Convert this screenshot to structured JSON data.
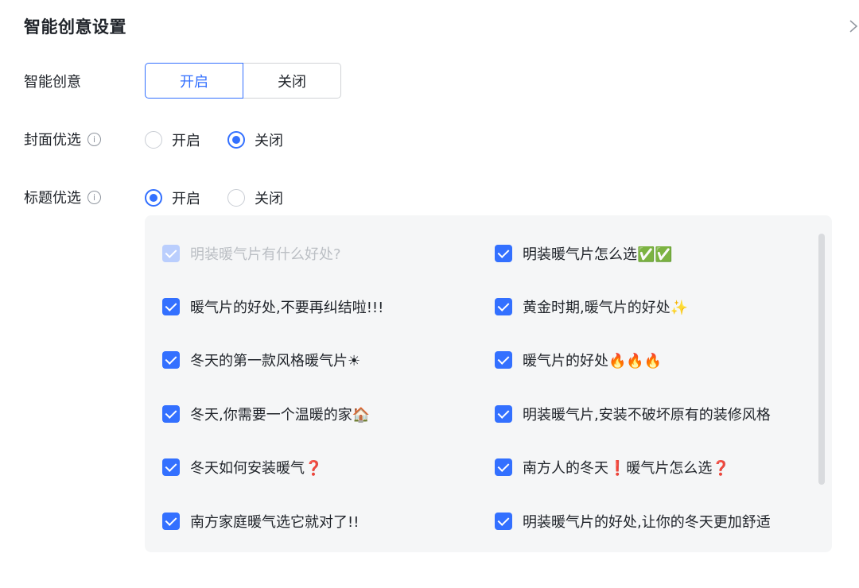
{
  "section": {
    "title": "智能创意设置"
  },
  "smart_creative": {
    "label": "智能创意",
    "options": [
      "开启",
      "关闭"
    ],
    "selected": "开启"
  },
  "cover_optimize": {
    "label": "封面优选",
    "info_icon": "info-icon",
    "options": [
      "开启",
      "关闭"
    ],
    "selected": "关闭"
  },
  "title_optimize": {
    "label": "标题优选",
    "info_icon": "info-icon",
    "options": [
      "开启",
      "关闭"
    ],
    "selected": "开启"
  },
  "titles": [
    {
      "text": "明装暖气片有什么好处?",
      "checked": true,
      "disabled": true
    },
    {
      "text": "明装暖气片怎么选✅✅",
      "checked": true,
      "disabled": false
    },
    {
      "text": "暖气片的好处,不要再纠结啦!!!",
      "checked": true,
      "disabled": false
    },
    {
      "text": "黄金时期,暖气片的好处✨",
      "checked": true,
      "disabled": false
    },
    {
      "text": "冬天的第一款风格暖气片☀",
      "checked": true,
      "disabled": false
    },
    {
      "text": "暖气片的好处🔥🔥🔥",
      "checked": true,
      "disabled": false
    },
    {
      "text": "冬天,你需要一个温暖的家🏠",
      "checked": true,
      "disabled": false
    },
    {
      "text": "明装暖气片,安装不破坏原有的装修风格",
      "checked": true,
      "disabled": false
    },
    {
      "text": "冬天如何安装暖气❓",
      "checked": true,
      "disabled": false
    },
    {
      "text": "南方人的冬天❗暖气片怎么选❓",
      "checked": true,
      "disabled": false
    },
    {
      "text": "南方家庭暖气选它就对了!!",
      "checked": true,
      "disabled": false
    },
    {
      "text": "明装暖气片的好处,让你的冬天更加舒适",
      "checked": true,
      "disabled": false
    }
  ],
  "colors": {
    "primary": "#3370ff",
    "text": "#1f2329",
    "disabled_text": "#bbbfc4",
    "panel_bg": "#f5f6f7"
  }
}
